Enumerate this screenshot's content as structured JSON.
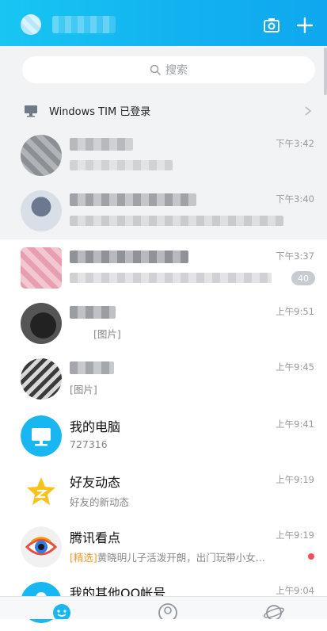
{
  "header": {
    "avatar": "avatar",
    "camera_icon": "camera-icon",
    "add_icon": "plus-icon"
  },
  "search": {
    "placeholder": "搜索",
    "icon": "search-icon"
  },
  "device_bar": {
    "label": "Windows TIM 已登录",
    "icon": "monitor-icon",
    "chevron": "chevron-right-icon"
  },
  "conversations": [
    {
      "time": "下午3:42",
      "pinned": true
    },
    {
      "time": "下午3:40",
      "pinned": true
    },
    {
      "time": "下午3:37",
      "unread": "40"
    },
    {
      "time": "上午9:51",
      "preview": "[图片]"
    },
    {
      "time": "上午9:45",
      "preview": "[图片]"
    },
    {
      "title": "我的电脑",
      "preview": "727316",
      "time": "上午9:41"
    },
    {
      "title": "好友动态",
      "preview": "好友的新动态",
      "time": "上午9:19"
    },
    {
      "title": "腾讯看点",
      "tag": "[精选]",
      "preview": "黄晓明儿子活泼开朗，出门玩带小女...",
      "time": "上午9:19",
      "red_dot": true
    },
    {
      "title": "我的其他QQ帐号",
      "time": "上午9:04"
    }
  ],
  "tabbar": {
    "items": [
      {
        "icon": "messages-tab-icon",
        "active": true
      },
      {
        "icon": "contacts-tab-icon"
      },
      {
        "icon": "discover-tab-icon"
      }
    ]
  },
  "colors": {
    "header_blue": "#12b2f0",
    "accent_orange": "#f09a2a",
    "red_dot": "#f2505a"
  }
}
